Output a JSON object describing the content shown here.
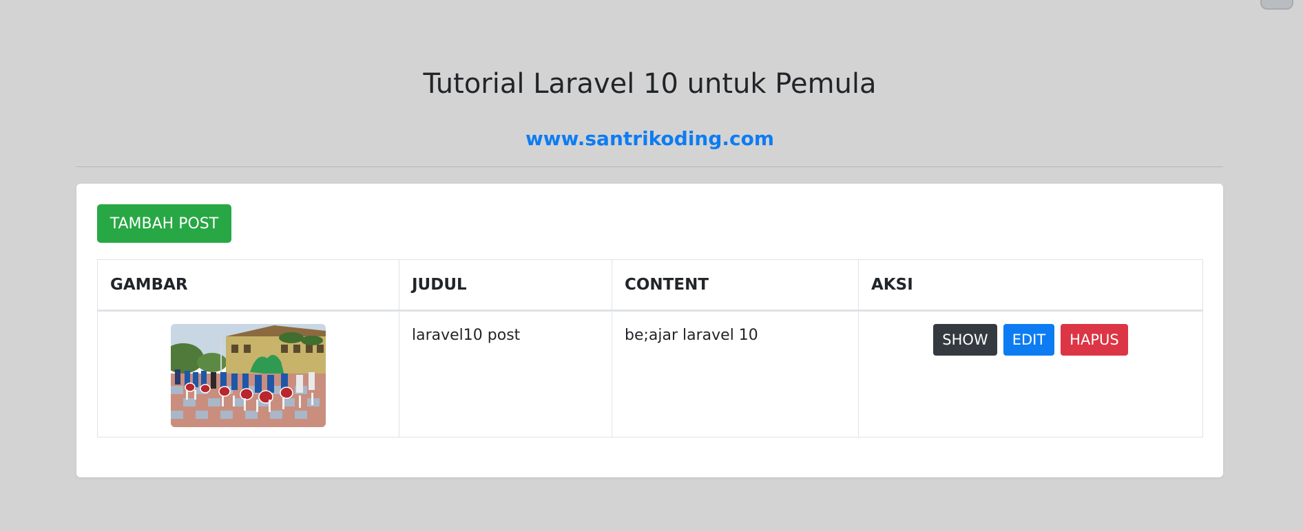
{
  "header": {
    "title": "Tutorial Laravel 10 untuk Pemula",
    "site_link": "www.santrikoding.com"
  },
  "toolbar": {
    "add_label": "TAMBAH POST"
  },
  "table": {
    "columns": [
      "GAMBAR",
      "JUDUL",
      "CONTENT",
      "AKSI"
    ],
    "rows": [
      {
        "image_icon": "photo-marching-band",
        "judul": "laravel10 post",
        "content": "be;ajar laravel 10",
        "actions": {
          "show": "SHOW",
          "edit": "EDIT",
          "delete": "HAPUS"
        }
      }
    ]
  },
  "colors": {
    "background": "#d3d3d3",
    "link": "#0d7cf2",
    "add_button": "#28a745",
    "show_button": "#343a40",
    "edit_button": "#0d7cf2",
    "delete_button": "#dc3545"
  }
}
